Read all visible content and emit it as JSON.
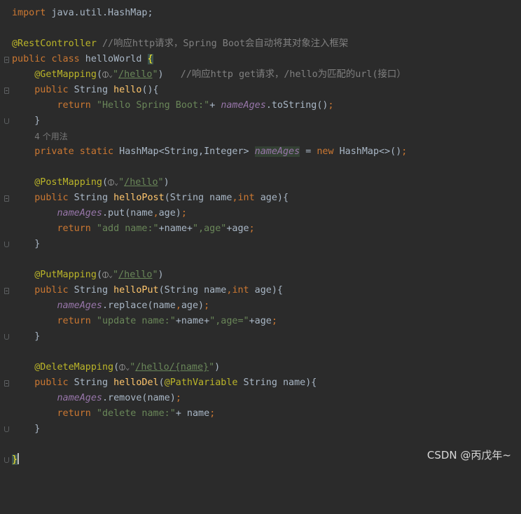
{
  "editor": {
    "l1": {
      "kw": "import",
      "rest": " java.util.HashMap;"
    },
    "l3": {
      "ann": "@RestController",
      "cmt": " //响应http请求，Spring Boot会自动将其对象注入框架"
    },
    "l4": {
      "kw1": "public",
      "kw2": "class",
      "name": " helloWorld ",
      "brace": "{"
    },
    "l5": {
      "ann": "@GetMapping",
      "open": "(",
      "str_open": "\"",
      "url": "/hello",
      "str_close": "\"",
      "close": ")",
      "cmt": "//响应http get请求，/hello为匹配的url(接口）"
    },
    "l6": {
      "kw": "public",
      "type": " String ",
      "fn": "hello",
      "rest": "(){"
    },
    "l7": {
      "kw": "return",
      "str": " \"Hello Spring Boot:\"",
      "plus": "+ ",
      "fld": "nameAges",
      "rest": ".toString()",
      "semi": ";"
    },
    "l8": {
      "text": "}"
    },
    "l9": {
      "hint": "4 个用法"
    },
    "l10": {
      "kw": "private static",
      "type": " HashMap<String,Integer> ",
      "fld": "nameAges",
      "eq": " = ",
      "kw2": "new",
      "rest": " HashMap<>()",
      "semi": ";"
    },
    "l12": {
      "ann": "@PostMapping",
      "open": "(",
      "str_open": "\"",
      "url": "/hello",
      "str_close": "\"",
      "close": ")"
    },
    "l13": {
      "kw": "public",
      "type": " String ",
      "fn": "helloPost",
      "p1": "(String name",
      "comma": ",",
      "kw2": "int",
      "p2": " age){"
    },
    "l14": {
      "fld": "nameAges",
      "rest": ".put(name",
      "comma": ",",
      "rest2": "age)",
      "semi": ";"
    },
    "l15": {
      "kw": "return",
      "str": " \"add name:\"",
      "mid": "+name+",
      "str2": "\",age\"",
      "end": "+age",
      "semi": ";"
    },
    "l16": {
      "text": "}"
    },
    "l18": {
      "ann": "@PutMapping",
      "open": "(",
      "str_open": "\"",
      "url": "/hello",
      "str_close": "\"",
      "close": ")"
    },
    "l19": {
      "kw": "public",
      "type": " String ",
      "fn": "helloPut",
      "p1": "(String name",
      "comma": ",",
      "kw2": "int",
      "p2": " age){"
    },
    "l20": {
      "fld": "nameAges",
      "rest": ".replace(name",
      "comma": ",",
      "rest2": "age)",
      "semi": ";"
    },
    "l21": {
      "kw": "return",
      "str": " \"update name:\"",
      "mid": "+name+",
      "str2": "\",age=\"",
      "end": "+age",
      "semi": ";"
    },
    "l22": {
      "text": "}"
    },
    "l24": {
      "ann": "@DeleteMapping",
      "open": "(",
      "str_open": "\"",
      "url": "/hello/{name}",
      "str_close": "\"",
      "close": ")"
    },
    "l25": {
      "kw": "public",
      "type": " String ",
      "fn": "helloDel",
      "p0": "(",
      "ann": "@PathVariable",
      "p1": " String name){"
    },
    "l26": {
      "fld": "nameAges",
      "rest": ".remove(name)",
      "semi": ";"
    },
    "l27": {
      "kw": "return",
      "str": " \"delete name:\"",
      "end": "+ name",
      "semi": ";"
    },
    "l28": {
      "text": "}"
    },
    "l30": {
      "brace": "}"
    }
  },
  "icons": {
    "globe": "globe-icon",
    "chevron": "chevron-down-icon"
  },
  "watermark": "CSDN @丙戊年~",
  "colors": {
    "background": "#2b2b2b",
    "keyword": "#cc7832",
    "annotation": "#bbb529",
    "string": "#6a8759",
    "comment": "#808080",
    "method": "#ffc66d",
    "field": "#9876aa"
  }
}
